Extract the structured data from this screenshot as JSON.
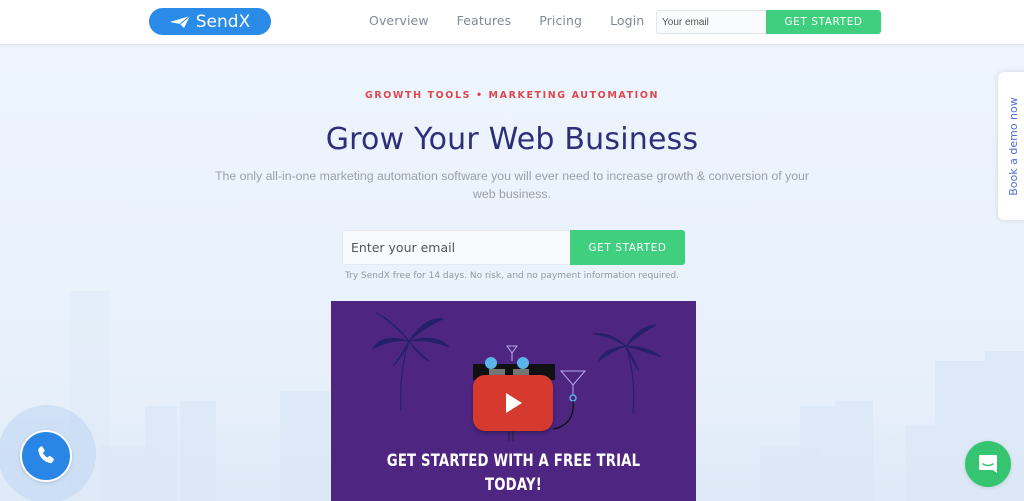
{
  "header": {
    "logo_text": "SendX",
    "nav": [
      {
        "label": "Overview"
      },
      {
        "label": "Features"
      },
      {
        "label": "Pricing"
      },
      {
        "label": "Login"
      }
    ],
    "email_placeholder": "Your email",
    "cta_label": "GET STARTED"
  },
  "hero": {
    "eyebrow": "GROWTH TOOLS • MARKETING AUTOMATION",
    "title": "Grow Your Web Business",
    "subtitle": "The only all-in-one marketing automation software you will ever need to increase growth & conversion of your web business.",
    "email_placeholder": "Enter your email",
    "cta_label": "GET STARTED",
    "note": "Try SendX free for 14 days. No risk, and no payment information required."
  },
  "video": {
    "caption_line1": "GET STARTED WITH A FREE TRIAL",
    "caption_line2": "TODAY!",
    "play_icon": "youtube-play-icon"
  },
  "side_tab": {
    "label": "Book a demo now"
  },
  "widgets": {
    "call_icon": "phone-icon",
    "chat_icon": "chat-icon"
  },
  "colors": {
    "brand_blue": "#2a8be8",
    "cta_green": "#3fcf7f",
    "eyebrow_red": "#e0474c",
    "title_navy": "#2e2f7a",
    "video_purple": "#4e2682",
    "chat_green": "#35c46f"
  }
}
